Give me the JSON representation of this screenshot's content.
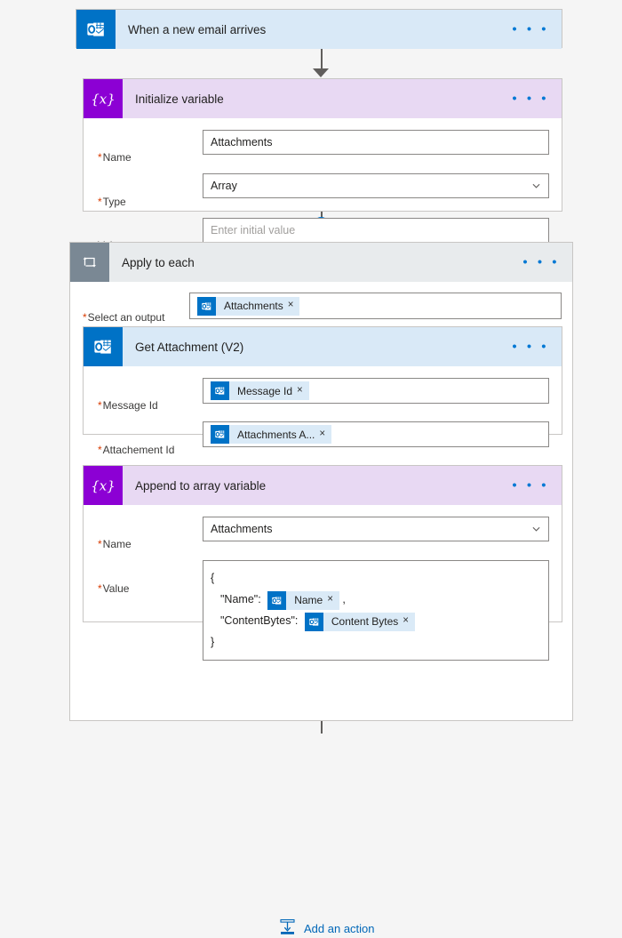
{
  "flow": {
    "trigger": {
      "title": "When a new email arrives",
      "icon": "outlook-icon",
      "more_label": "• • •"
    },
    "initialize_variable": {
      "title": "Initialize variable",
      "icon": "variable-icon",
      "more_label": "• • •",
      "fields": [
        {
          "label": "Name",
          "required": true,
          "value": "Attachments",
          "control": "text"
        },
        {
          "label": "Type",
          "required": true,
          "value": "Array",
          "control": "dropdown"
        },
        {
          "label": "Value",
          "required": false,
          "value": "",
          "placeholder": "Enter initial value",
          "control": "text"
        }
      ]
    },
    "apply_to_each": {
      "title": "Apply to each",
      "icon": "loop-icon",
      "more_label": "• • •",
      "select_output": {
        "label": "Select an output\nfrom previous steps",
        "required": true,
        "token": {
          "text": "Attachments",
          "icon": "outlook-icon",
          "remove": "×"
        }
      },
      "add_action": {
        "label": "Add an action",
        "icon": "insert-action-icon"
      }
    },
    "get_attachment": {
      "title": "Get Attachment (V2)",
      "icon": "outlook-icon",
      "more_label": "• • •",
      "fields": [
        {
          "label": "Message Id",
          "required": true,
          "token": {
            "text": "Message Id",
            "icon": "outlook-icon",
            "remove": "×"
          }
        },
        {
          "label": "Attachement Id",
          "required": true,
          "token": {
            "text": "Attachments A...",
            "icon": "outlook-icon",
            "remove": "×"
          }
        }
      ]
    },
    "append_to_array": {
      "title": "Append to array variable",
      "icon": "variable-icon",
      "more_label": "• • •",
      "name_field": {
        "label": "Name",
        "required": true,
        "value": "Attachments",
        "control": "dropdown"
      },
      "value_field": {
        "label": "Value",
        "required": true,
        "lines": [
          {
            "text": "{",
            "indent": false
          },
          {
            "text": "\"Name\":",
            "indent": true,
            "token": {
              "text": "Name",
              "icon": "outlook-icon",
              "remove": "×"
            },
            "suffix": ","
          },
          {
            "text": "\"ContentBytes\":",
            "indent": true,
            "token": {
              "text": "Content Bytes",
              "icon": "outlook-icon",
              "remove": "×"
            },
            "suffix": ""
          },
          {
            "text": "}",
            "indent": false
          }
        ]
      }
    }
  },
  "colors": {
    "outlook_blue": "#0072c6",
    "variable_purple": "#8c00d4",
    "loop_gray": "#7a8894",
    "header_blue": "#d9e9f7",
    "header_purple": "#e8d9f3",
    "header_gray": "#e8ebed",
    "link_blue": "#0067b8",
    "required_red": "#d83b01",
    "canvas": "#f5f5f5"
  }
}
